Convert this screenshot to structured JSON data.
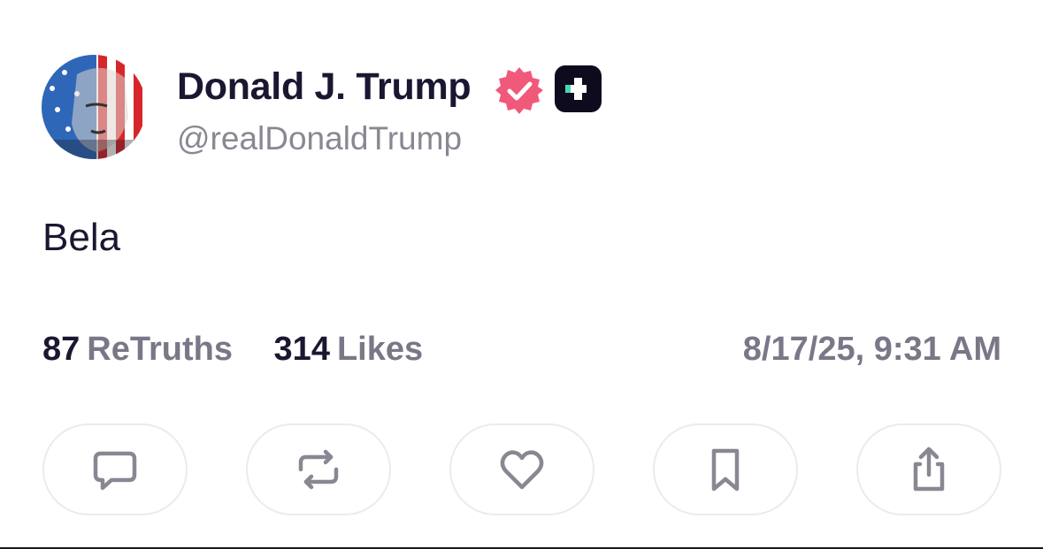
{
  "post": {
    "author": {
      "display_name": "Donald J. Trump",
      "handle": "@realDonaldTrump",
      "avatar": "flag-painted-portrait",
      "verified_icon": "verified-badge-icon",
      "plus_icon": "truth-plus-icon"
    },
    "text": "Bela",
    "stats": {
      "retruths_count": "87",
      "retruths_label": "ReTruths",
      "likes_count": "314",
      "likes_label": "Likes"
    },
    "timestamp": "8/17/25, 9:31 AM"
  },
  "actions": [
    {
      "name": "reply",
      "icon": "comment-icon"
    },
    {
      "name": "retruth",
      "icon": "repost-icon"
    },
    {
      "name": "like",
      "icon": "heart-icon"
    },
    {
      "name": "bookmark",
      "icon": "bookmark-icon"
    },
    {
      "name": "share",
      "icon": "share-icon"
    }
  ],
  "colors": {
    "text_primary": "#1b1731",
    "text_secondary": "#7b7787",
    "verified": "#f0597a",
    "plus_bg": "#0f0b1e",
    "plus_accent": "#46d6b4",
    "icon": "#8a8793",
    "button_border": "#ebeaef"
  }
}
